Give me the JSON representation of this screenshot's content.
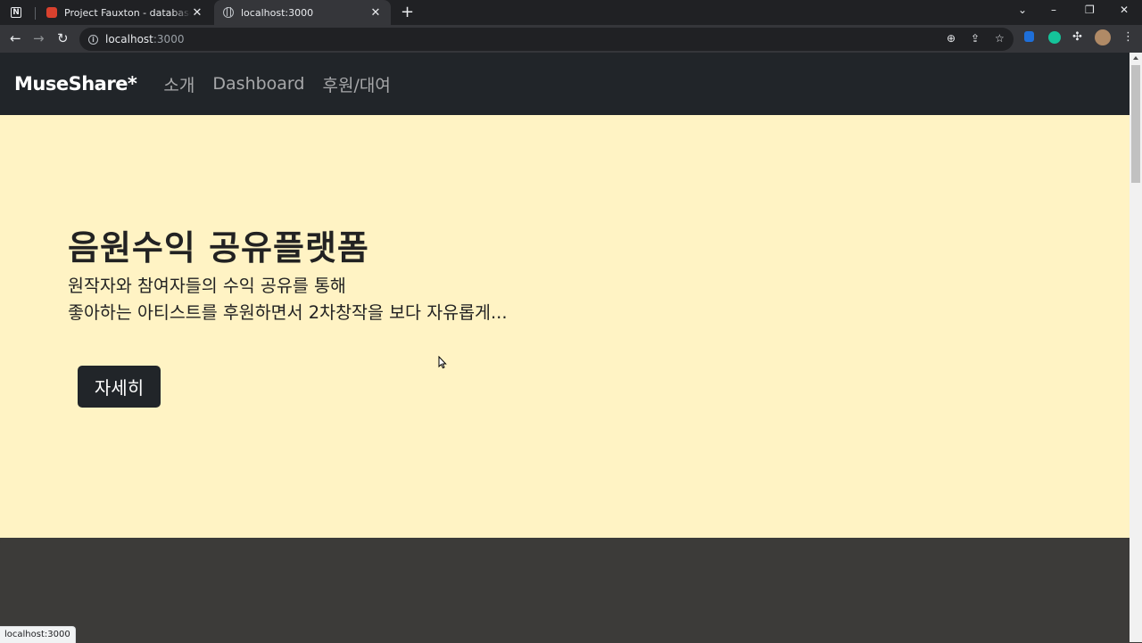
{
  "browser": {
    "tabs": [
      {
        "title": "Project Fauxton - database/msh",
        "active": false
      },
      {
        "title": "localhost:3000",
        "active": true
      }
    ],
    "url_host": "localhost",
    "url_port": ":3000",
    "status_url": "localhost:3000"
  },
  "site": {
    "brand": "MuseShare*",
    "nav": [
      "소개",
      "Dashboard",
      "후원/대여"
    ],
    "hero": {
      "title": "음원수익 공유플랫폼",
      "lead_line1": "원작자와 참여자들의 수익 공유를 통해",
      "lead_line2": "좋아하는 아티스트를 후원하면서 2차창작을 보다 자유롭게...",
      "button": "자세히"
    }
  },
  "colors": {
    "navbar": "#212529",
    "hero_bg": "#fff3c4",
    "dark_section": "#3c3b39"
  }
}
